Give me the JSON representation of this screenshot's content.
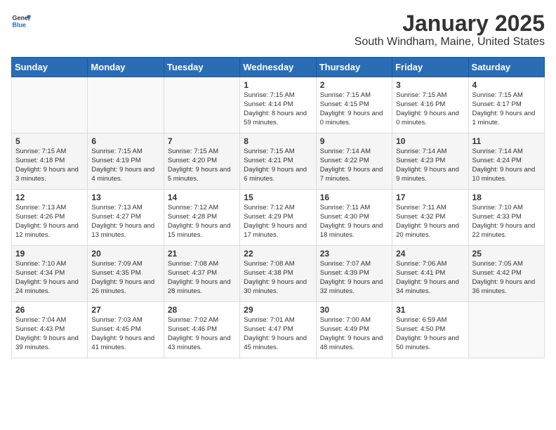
{
  "logo": {
    "general": "General",
    "blue": "Blue"
  },
  "title": "January 2025",
  "subtitle": "South Windham, Maine, United States",
  "days_of_week": [
    "Sunday",
    "Monday",
    "Tuesday",
    "Wednesday",
    "Thursday",
    "Friday",
    "Saturday"
  ],
  "weeks": [
    [
      {
        "day": "",
        "content": ""
      },
      {
        "day": "",
        "content": ""
      },
      {
        "day": "",
        "content": ""
      },
      {
        "day": "1",
        "content": "Sunrise: 7:15 AM\nSunset: 4:14 PM\nDaylight: 8 hours and 59 minutes."
      },
      {
        "day": "2",
        "content": "Sunrise: 7:15 AM\nSunset: 4:15 PM\nDaylight: 9 hours and 0 minutes."
      },
      {
        "day": "3",
        "content": "Sunrise: 7:15 AM\nSunset: 4:16 PM\nDaylight: 9 hours and 0 minutes."
      },
      {
        "day": "4",
        "content": "Sunrise: 7:15 AM\nSunset: 4:17 PM\nDaylight: 9 hours and 1 minute."
      }
    ],
    [
      {
        "day": "5",
        "content": "Sunrise: 7:15 AM\nSunset: 4:18 PM\nDaylight: 9 hours and 3 minutes."
      },
      {
        "day": "6",
        "content": "Sunrise: 7:15 AM\nSunset: 4:19 PM\nDaylight: 9 hours and 4 minutes."
      },
      {
        "day": "7",
        "content": "Sunrise: 7:15 AM\nSunset: 4:20 PM\nDaylight: 9 hours and 5 minutes."
      },
      {
        "day": "8",
        "content": "Sunrise: 7:15 AM\nSunset: 4:21 PM\nDaylight: 9 hours and 6 minutes."
      },
      {
        "day": "9",
        "content": "Sunrise: 7:14 AM\nSunset: 4:22 PM\nDaylight: 9 hours and 7 minutes."
      },
      {
        "day": "10",
        "content": "Sunrise: 7:14 AM\nSunset: 4:23 PM\nDaylight: 9 hours and 9 minutes."
      },
      {
        "day": "11",
        "content": "Sunrise: 7:14 AM\nSunset: 4:24 PM\nDaylight: 9 hours and 10 minutes."
      }
    ],
    [
      {
        "day": "12",
        "content": "Sunrise: 7:13 AM\nSunset: 4:26 PM\nDaylight: 9 hours and 12 minutes."
      },
      {
        "day": "13",
        "content": "Sunrise: 7:13 AM\nSunset: 4:27 PM\nDaylight: 9 hours and 13 minutes."
      },
      {
        "day": "14",
        "content": "Sunrise: 7:12 AM\nSunset: 4:28 PM\nDaylight: 9 hours and 15 minutes."
      },
      {
        "day": "15",
        "content": "Sunrise: 7:12 AM\nSunset: 4:29 PM\nDaylight: 9 hours and 17 minutes."
      },
      {
        "day": "16",
        "content": "Sunrise: 7:11 AM\nSunset: 4:30 PM\nDaylight: 9 hours and 18 minutes."
      },
      {
        "day": "17",
        "content": "Sunrise: 7:11 AM\nSunset: 4:32 PM\nDaylight: 9 hours and 20 minutes."
      },
      {
        "day": "18",
        "content": "Sunrise: 7:10 AM\nSunset: 4:33 PM\nDaylight: 9 hours and 22 minutes."
      }
    ],
    [
      {
        "day": "19",
        "content": "Sunrise: 7:10 AM\nSunset: 4:34 PM\nDaylight: 9 hours and 24 minutes."
      },
      {
        "day": "20",
        "content": "Sunrise: 7:09 AM\nSunset: 4:35 PM\nDaylight: 9 hours and 26 minutes."
      },
      {
        "day": "21",
        "content": "Sunrise: 7:08 AM\nSunset: 4:37 PM\nDaylight: 9 hours and 28 minutes."
      },
      {
        "day": "22",
        "content": "Sunrise: 7:08 AM\nSunset: 4:38 PM\nDaylight: 9 hours and 30 minutes."
      },
      {
        "day": "23",
        "content": "Sunrise: 7:07 AM\nSunset: 4:39 PM\nDaylight: 9 hours and 32 minutes."
      },
      {
        "day": "24",
        "content": "Sunrise: 7:06 AM\nSunset: 4:41 PM\nDaylight: 9 hours and 34 minutes."
      },
      {
        "day": "25",
        "content": "Sunrise: 7:05 AM\nSunset: 4:42 PM\nDaylight: 9 hours and 36 minutes."
      }
    ],
    [
      {
        "day": "26",
        "content": "Sunrise: 7:04 AM\nSunset: 4:43 PM\nDaylight: 9 hours and 39 minutes."
      },
      {
        "day": "27",
        "content": "Sunrise: 7:03 AM\nSunset: 4:45 PM\nDaylight: 9 hours and 41 minutes."
      },
      {
        "day": "28",
        "content": "Sunrise: 7:02 AM\nSunset: 4:46 PM\nDaylight: 9 hours and 43 minutes."
      },
      {
        "day": "29",
        "content": "Sunrise: 7:01 AM\nSunset: 4:47 PM\nDaylight: 9 hours and 45 minutes."
      },
      {
        "day": "30",
        "content": "Sunrise: 7:00 AM\nSunset: 4:49 PM\nDaylight: 9 hours and 48 minutes."
      },
      {
        "day": "31",
        "content": "Sunrise: 6:59 AM\nSunset: 4:50 PM\nDaylight: 9 hours and 50 minutes."
      },
      {
        "day": "",
        "content": ""
      }
    ]
  ]
}
